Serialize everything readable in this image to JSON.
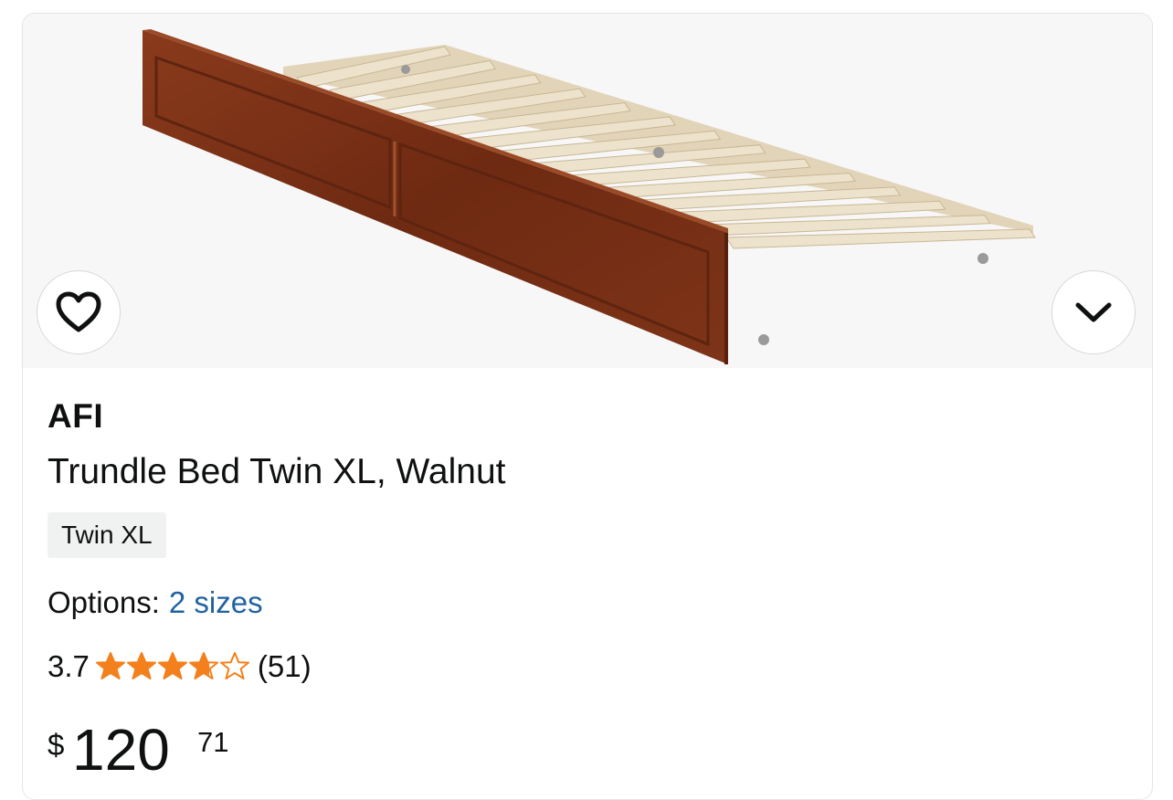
{
  "product": {
    "brand": "AFI",
    "title": "Trundle Bed Twin XL, Walnut",
    "size_badge": "Twin XL",
    "options_label": "Options:",
    "options_link": "2 sizes",
    "rating_value": "3.7",
    "rating": 3.7,
    "rating_max": 5,
    "review_count": "(51)",
    "price": {
      "symbol": "$",
      "whole": "120",
      "fraction": "71"
    }
  },
  "icons": {
    "favorite": "heart-outline-icon",
    "expand": "chevron-down-icon",
    "star": "star-icon"
  },
  "colors": {
    "star": "#f3801c",
    "link": "#2162a1",
    "wood": "#7a3218",
    "slat": "#ece0c8"
  }
}
